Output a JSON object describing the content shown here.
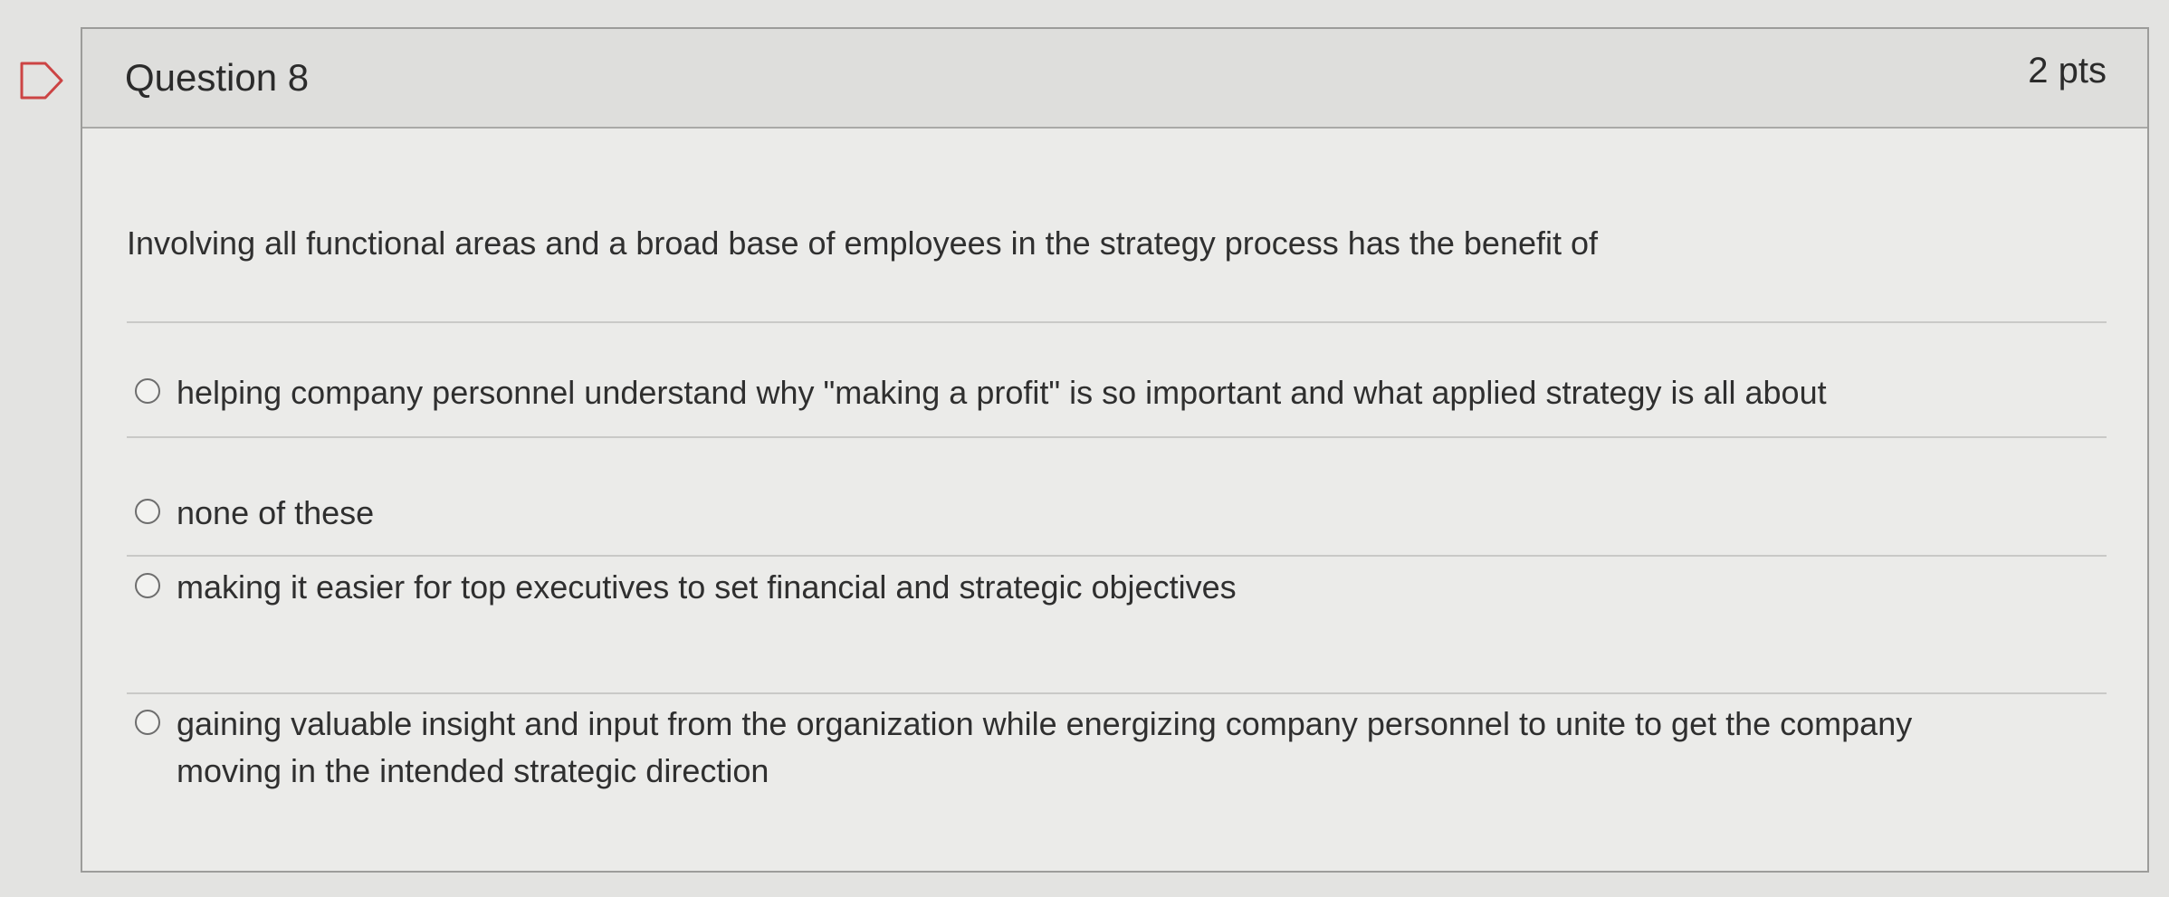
{
  "question": {
    "title": "Question 8",
    "points": "2 pts",
    "prompt": "Involving all functional areas and a broad base of employees in the strategy process has the benefit of"
  },
  "answers": [
    {
      "label": "helping company personnel understand why \"making a profit\" is so important and what applied strategy is all about"
    },
    {
      "label": "none of these"
    },
    {
      "label": "making it easier for top executives to set financial and strategic objectives"
    },
    {
      "label": "gaining valuable insight and input from the organization while energizing company personnel to unite to get the company moving in the intended strategic direction"
    }
  ],
  "icons": {
    "flag": "flag-question-icon",
    "radio": "radio-button"
  },
  "colors": {
    "background": "#e3e3e1",
    "card": "#ebebe9",
    "header": "#dededc",
    "text": "#2f2f2f",
    "border": "#9c9c9a"
  }
}
